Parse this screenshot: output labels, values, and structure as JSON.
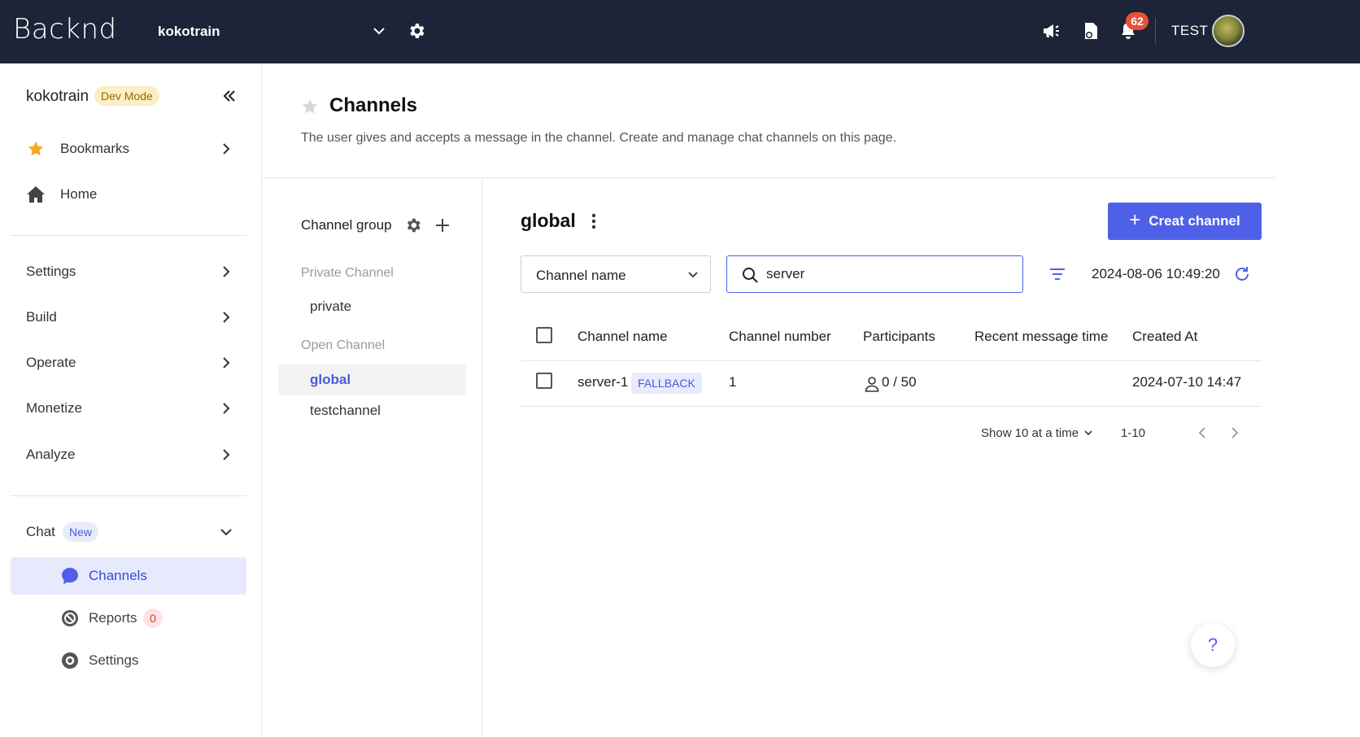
{
  "topbar": {
    "logo": "Backnd",
    "project": "kokotrain",
    "notification_count": "62",
    "user": "TEST"
  },
  "sidebar": {
    "project_name": "kokotrain",
    "mode_badge": "Dev Mode",
    "items": [
      {
        "label": "Bookmarks",
        "icon": "star-icon"
      },
      {
        "label": "Home",
        "icon": "home-icon"
      }
    ],
    "sections": [
      "Settings",
      "Build",
      "Operate",
      "Monetize",
      "Analyze"
    ],
    "chat": {
      "label": "Chat",
      "badge": "New",
      "children": [
        {
          "label": "Channels",
          "icon": "chat-bubble-icon",
          "active": true
        },
        {
          "label": "Reports",
          "icon": "report-icon",
          "count": "0"
        },
        {
          "label": "Settings",
          "icon": "gear-icon"
        }
      ]
    }
  },
  "page": {
    "title": "Channels",
    "description": "The user gives and accepts a message in the channel. Create and manage chat channels on this page."
  },
  "channel_groups": {
    "title": "Channel group",
    "sections": [
      {
        "label": "Private Channel",
        "items": [
          "private"
        ]
      },
      {
        "label": "Open Channel",
        "items": [
          "global",
          "testchannel"
        ]
      }
    ],
    "active": "global"
  },
  "channel_panel": {
    "title": "global",
    "create_button": "Creat channel",
    "filter_select": "Channel name",
    "search_value": "server",
    "timestamp": "2024-08-06 10:49:20",
    "columns": [
      "Channel name",
      "Channel number",
      "Participants",
      "Recent message time",
      "Created At"
    ],
    "rows": [
      {
        "name": "server-1",
        "tag": "FALLBACK",
        "number": "1",
        "participants": "0 / 50",
        "recent_message_time": "",
        "created_at": "2024-07-10 14:47"
      }
    ],
    "pagination": {
      "page_size_label": "Show 10 at a time",
      "range": "1-10"
    }
  },
  "help": "?",
  "colors": {
    "topbar_bg": "#1d2437",
    "accent": "#4f60e8",
    "notification": "#e8503a",
    "bookmark_star": "#f5a623"
  }
}
